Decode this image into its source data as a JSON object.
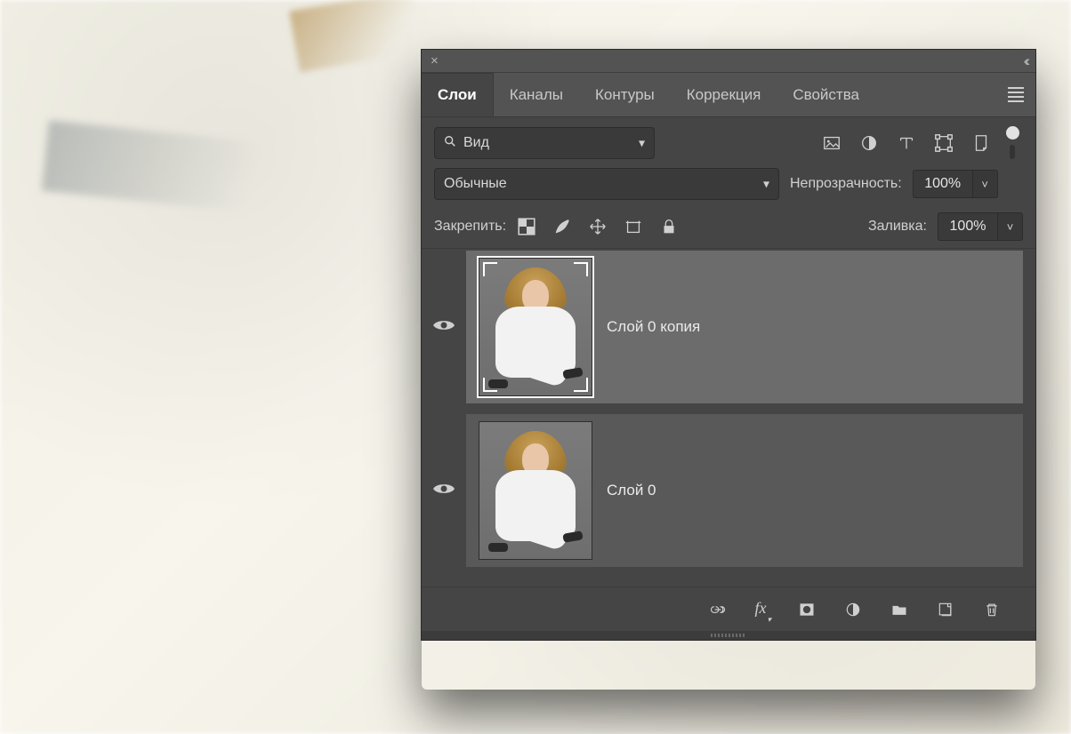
{
  "tabs": {
    "layers": "Слои",
    "channels": "Каналы",
    "paths": "Контуры",
    "adjustments": "Коррекция",
    "properties": "Свойства"
  },
  "filter": {
    "value": "Вид"
  },
  "blend": {
    "mode": "Обычные",
    "opacity_label": "Непрозрачность:",
    "opacity_value": "100%"
  },
  "lock": {
    "label": "Закрепить:",
    "fill_label": "Заливка:",
    "fill_value": "100%"
  },
  "layers": [
    {
      "name": "Слой 0 копия",
      "selected": true
    },
    {
      "name": "Слой 0",
      "selected": false
    }
  ]
}
